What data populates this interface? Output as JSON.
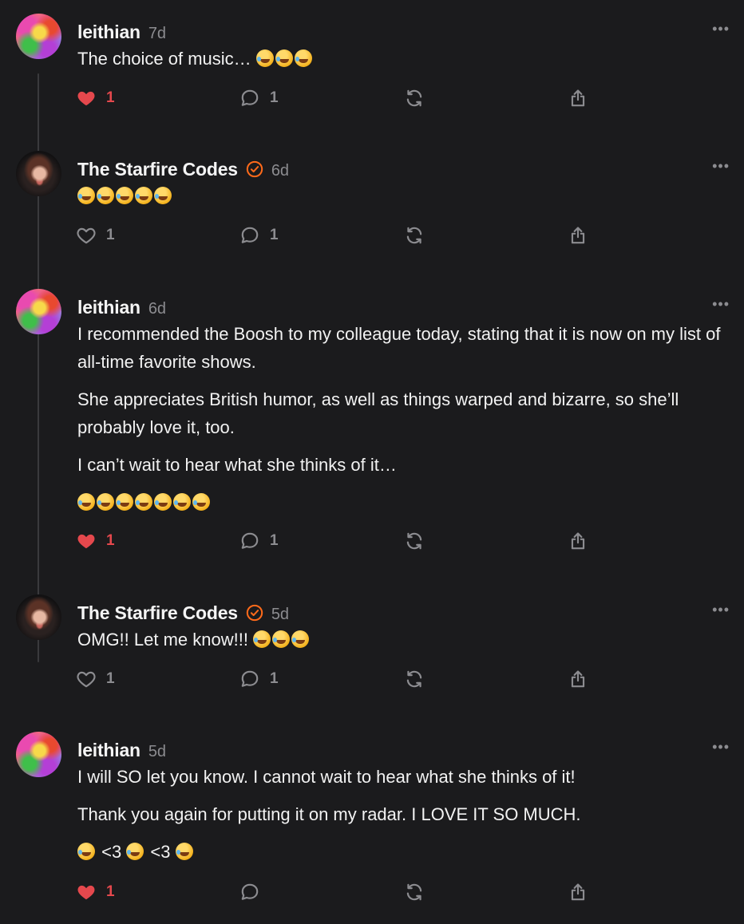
{
  "colors": {
    "background": "#1b1b1d",
    "text": "#f2f2f2",
    "muted": "#8c8c90",
    "like_active": "#e5484d",
    "verified_badge": "#ff6a1a"
  },
  "comments": [
    {
      "author": "leithian",
      "time": "7d",
      "verified": false,
      "paragraphs": [
        "The choice of music… 🤣🤣🤣"
      ],
      "likes": "1",
      "liked": true,
      "replies": "1"
    },
    {
      "author": "The Starfire Codes",
      "time": "6d",
      "verified": true,
      "paragraphs": [
        "🤣🤣🤣🤣🤣"
      ],
      "likes": "1",
      "liked": false,
      "replies": "1"
    },
    {
      "author": "leithian",
      "time": "6d",
      "verified": false,
      "paragraphs": [
        "I recommended the Boosh to my colleague today, stating that it is now on my list of all-time favorite shows.",
        "She appreciates British humor, as well as things warped and bizarre, so she’ll probably love it, too.",
        "I can’t wait to hear what she thinks of it…",
        "🤣🤣🤣🤣🤣🤣🤣"
      ],
      "likes": "1",
      "liked": true,
      "replies": "1"
    },
    {
      "author": "The Starfire Codes",
      "time": "5d",
      "verified": true,
      "paragraphs": [
        "OMG!! Let me know!!! 🤣🤣🤣"
      ],
      "likes": "1",
      "liked": false,
      "replies": "1"
    },
    {
      "author": "leithian",
      "time": "5d",
      "verified": false,
      "paragraphs": [
        "I will SO let you know. I cannot wait to hear what she thinks of it!",
        "Thank you again for putting it on my radar. I LOVE IT SO MUCH.",
        "🤣 <3 🤣 <3 🤣"
      ],
      "likes": "1",
      "liked": true,
      "replies": ""
    }
  ],
  "icons": {
    "like": "heart-icon",
    "reply": "comment-bubble-icon",
    "restack": "restack-icon",
    "share": "share-icon",
    "more": "more-dots-icon",
    "verified": "verified-badge-icon"
  }
}
